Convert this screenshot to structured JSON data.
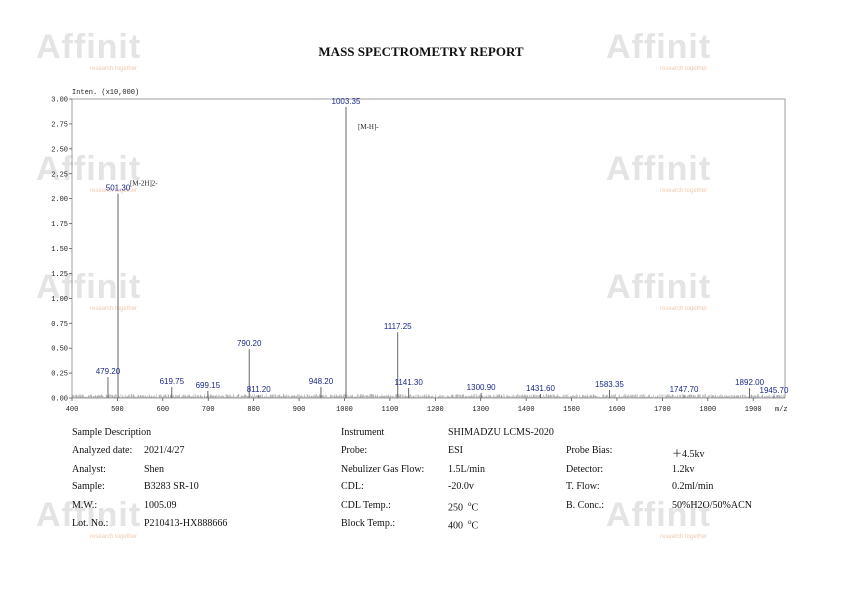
{
  "report_title": "MASS SPECTROMETRY REPORT",
  "watermark": {
    "brand": "Affinit",
    "tagline": "research together"
  },
  "chart_data": {
    "type": "line",
    "title": "",
    "ylabel": "Inten. (x10,000)",
    "xlabel": "m/z",
    "xlim": [
      400,
      1970
    ],
    "ylim": [
      0,
      3.0
    ],
    "xticks": [
      400,
      500,
      600,
      700,
      800,
      900,
      1000,
      1100,
      1200,
      1300,
      1400,
      1500,
      1600,
      1700,
      1800,
      1900
    ],
    "xtick_labels": [
      "400",
      "500",
      "600",
      "700",
      "800",
      "900",
      "1000",
      "1100",
      "1200",
      "1300",
      "1400",
      "1500",
      "1600",
      "1700",
      "1800",
      "1900"
    ],
    "yticks": [
      0,
      0.25,
      0.5,
      0.75,
      1.0,
      1.25,
      1.5,
      1.75,
      2.0,
      2.25,
      2.5,
      2.75,
      3.0
    ],
    "ytick_labels": [
      "0.00",
      "0.25",
      "0.50",
      "0.75",
      "1.00",
      "1.25",
      "1.50",
      "1.75",
      "2.00",
      "2.25",
      "2.50",
      "2.75",
      "3.00"
    ],
    "peaks": [
      {
        "mz": 479.2,
        "intensity": 0.21,
        "label": "479.20"
      },
      {
        "mz": 501.3,
        "intensity": 2.05,
        "label": "501.30"
      },
      {
        "mz": 619.75,
        "intensity": 0.11,
        "label": "619.75"
      },
      {
        "mz": 699.15,
        "intensity": 0.07,
        "label": "699.15"
      },
      {
        "mz": 790.2,
        "intensity": 0.49,
        "label": "790.20"
      },
      {
        "mz": 811.2,
        "intensity": 0.03,
        "label": "811.20"
      },
      {
        "mz": 948.2,
        "intensity": 0.11,
        "label": "948.20"
      },
      {
        "mz": 1003.35,
        "intensity": 2.92,
        "label": "1003.35"
      },
      {
        "mz": 1117.25,
        "intensity": 0.66,
        "label": "1117.25"
      },
      {
        "mz": 1141.3,
        "intensity": 0.1,
        "label": "1141.30"
      },
      {
        "mz": 1300.9,
        "intensity": 0.05,
        "label": "1300.90"
      },
      {
        "mz": 1431.6,
        "intensity": 0.04,
        "label": "1431.60"
      },
      {
        "mz": 1583.35,
        "intensity": 0.08,
        "label": "1583.35"
      },
      {
        "mz": 1747.7,
        "intensity": 0.03,
        "label": "1747.70"
      },
      {
        "mz": 1892.0,
        "intensity": 0.1,
        "label": "1892.00"
      },
      {
        "mz": 1945.7,
        "intensity": 0.02,
        "label": "1945.70"
      }
    ],
    "annotations": [
      {
        "text": "[M-H]-",
        "mz": 1003.35,
        "intensity": 2.7
      },
      {
        "text": "[M-2H]2-",
        "mz": 501.3,
        "intensity": 2.13
      }
    ],
    "colors": {
      "peak_label": "#1a2a8a",
      "trace": "#555555",
      "axis": "#888888"
    }
  },
  "sample_description": {
    "heading": "Sample Description",
    "rows": [
      {
        "label": "Analyzed date:",
        "value": "2021/4/27"
      },
      {
        "label": "Analyst:",
        "value": "Shen"
      },
      {
        "label": "Sample:",
        "value": "B3283 SR-10"
      },
      {
        "label": "M.W.:",
        "value": "1005.09"
      },
      {
        "label": "Lot. No.:",
        "value": "P210413-HX888666"
      }
    ]
  },
  "instrument": {
    "heading": "Instrument",
    "name": "SHIMADZU LCMS-2020",
    "rows": [
      {
        "label": "Probe:",
        "value": "ESI"
      },
      {
        "label": "Nebulizer Gas Flow:",
        "value": "1.5L/min"
      },
      {
        "label": "CDL:",
        "value": "-20.0v"
      },
      {
        "label": "CDL Temp.:",
        "value": "250",
        "unit_sup": "o",
        "unit": "C"
      },
      {
        "label": "Block Temp.:",
        "value": "400",
        "unit_sup": "o",
        "unit": "C"
      }
    ],
    "right_rows": [
      {
        "label": "Probe Bias:",
        "value": "＋4.5kv"
      },
      {
        "label": "Detector:",
        "value": "1.2kv"
      },
      {
        "label": "T. Flow:",
        "value": "0.2ml/min"
      },
      {
        "label": "B. Conc.:",
        "value": "50%H2O/50%ACN"
      }
    ]
  }
}
